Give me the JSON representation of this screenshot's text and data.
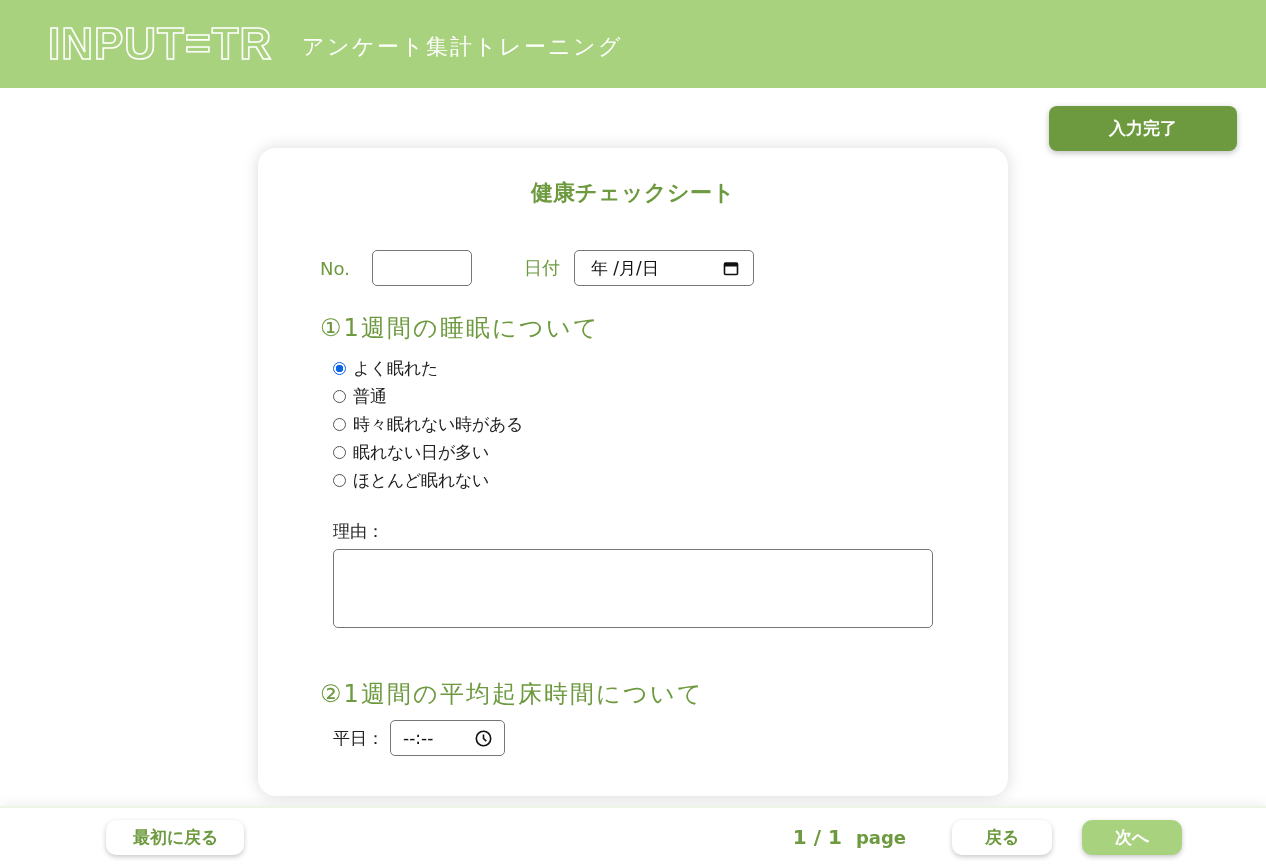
{
  "header": {
    "logo": "INPUT=TR",
    "subtitle": "アンケート集計トレーニング"
  },
  "complete_button": "入力完了",
  "sheet": {
    "title": "健康チェックシート",
    "no_field": {
      "label": "No."
    },
    "date_field": {
      "label": "日付",
      "placeholder": "年 /月/日"
    },
    "sections": [
      {
        "kind": "radio",
        "heading": "①1週間の睡眠について",
        "options": [
          {
            "label": "よく眠れた",
            "selected": true
          },
          {
            "label": "普通",
            "selected": false
          },
          {
            "label": "時々眠れない時がある",
            "selected": false
          },
          {
            "label": "眠れない日が多い",
            "selected": false
          },
          {
            "label": "ほとんど眠れない",
            "selected": false
          }
        ],
        "reason_label": "理由："
      },
      {
        "kind": "time",
        "heading": "②1週間の平均起床時間について",
        "rows": [
          {
            "label": "平日：",
            "placeholder": "--:--"
          }
        ]
      }
    ]
  },
  "footer": {
    "first_button": "最初に戻る",
    "page_current": "1 / 1",
    "page_unit": "page",
    "back_button": "戻る",
    "next_button": "次へ"
  }
}
